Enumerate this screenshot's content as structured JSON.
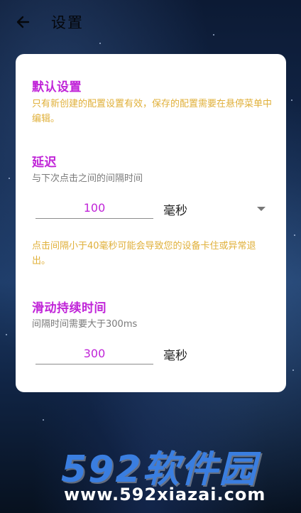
{
  "header": {
    "title": "设置",
    "back_icon": "arrow-left-icon"
  },
  "card": {
    "default_settings": {
      "title": "默认设置",
      "description": "只有新创建的配置设置有效，保存的配置需要在悬停菜单中编辑。"
    },
    "delay": {
      "title": "延迟",
      "subtitle": "与下次点击之间的间隔时间",
      "value": "100",
      "unit": "毫秒",
      "warning": "点击间隔小于40毫秒可能会导致您的设备卡住或异常退出。"
    },
    "swipe_duration": {
      "title": "滑动持续时间",
      "subtitle": "间隔时间需要大于300ms",
      "value": "300",
      "unit": "毫秒"
    }
  },
  "watermark": {
    "brand": "592软件园",
    "url": "www.592xiazai.com"
  },
  "colors": {
    "accent": "#c024d8",
    "warning": "#e0b03a"
  }
}
